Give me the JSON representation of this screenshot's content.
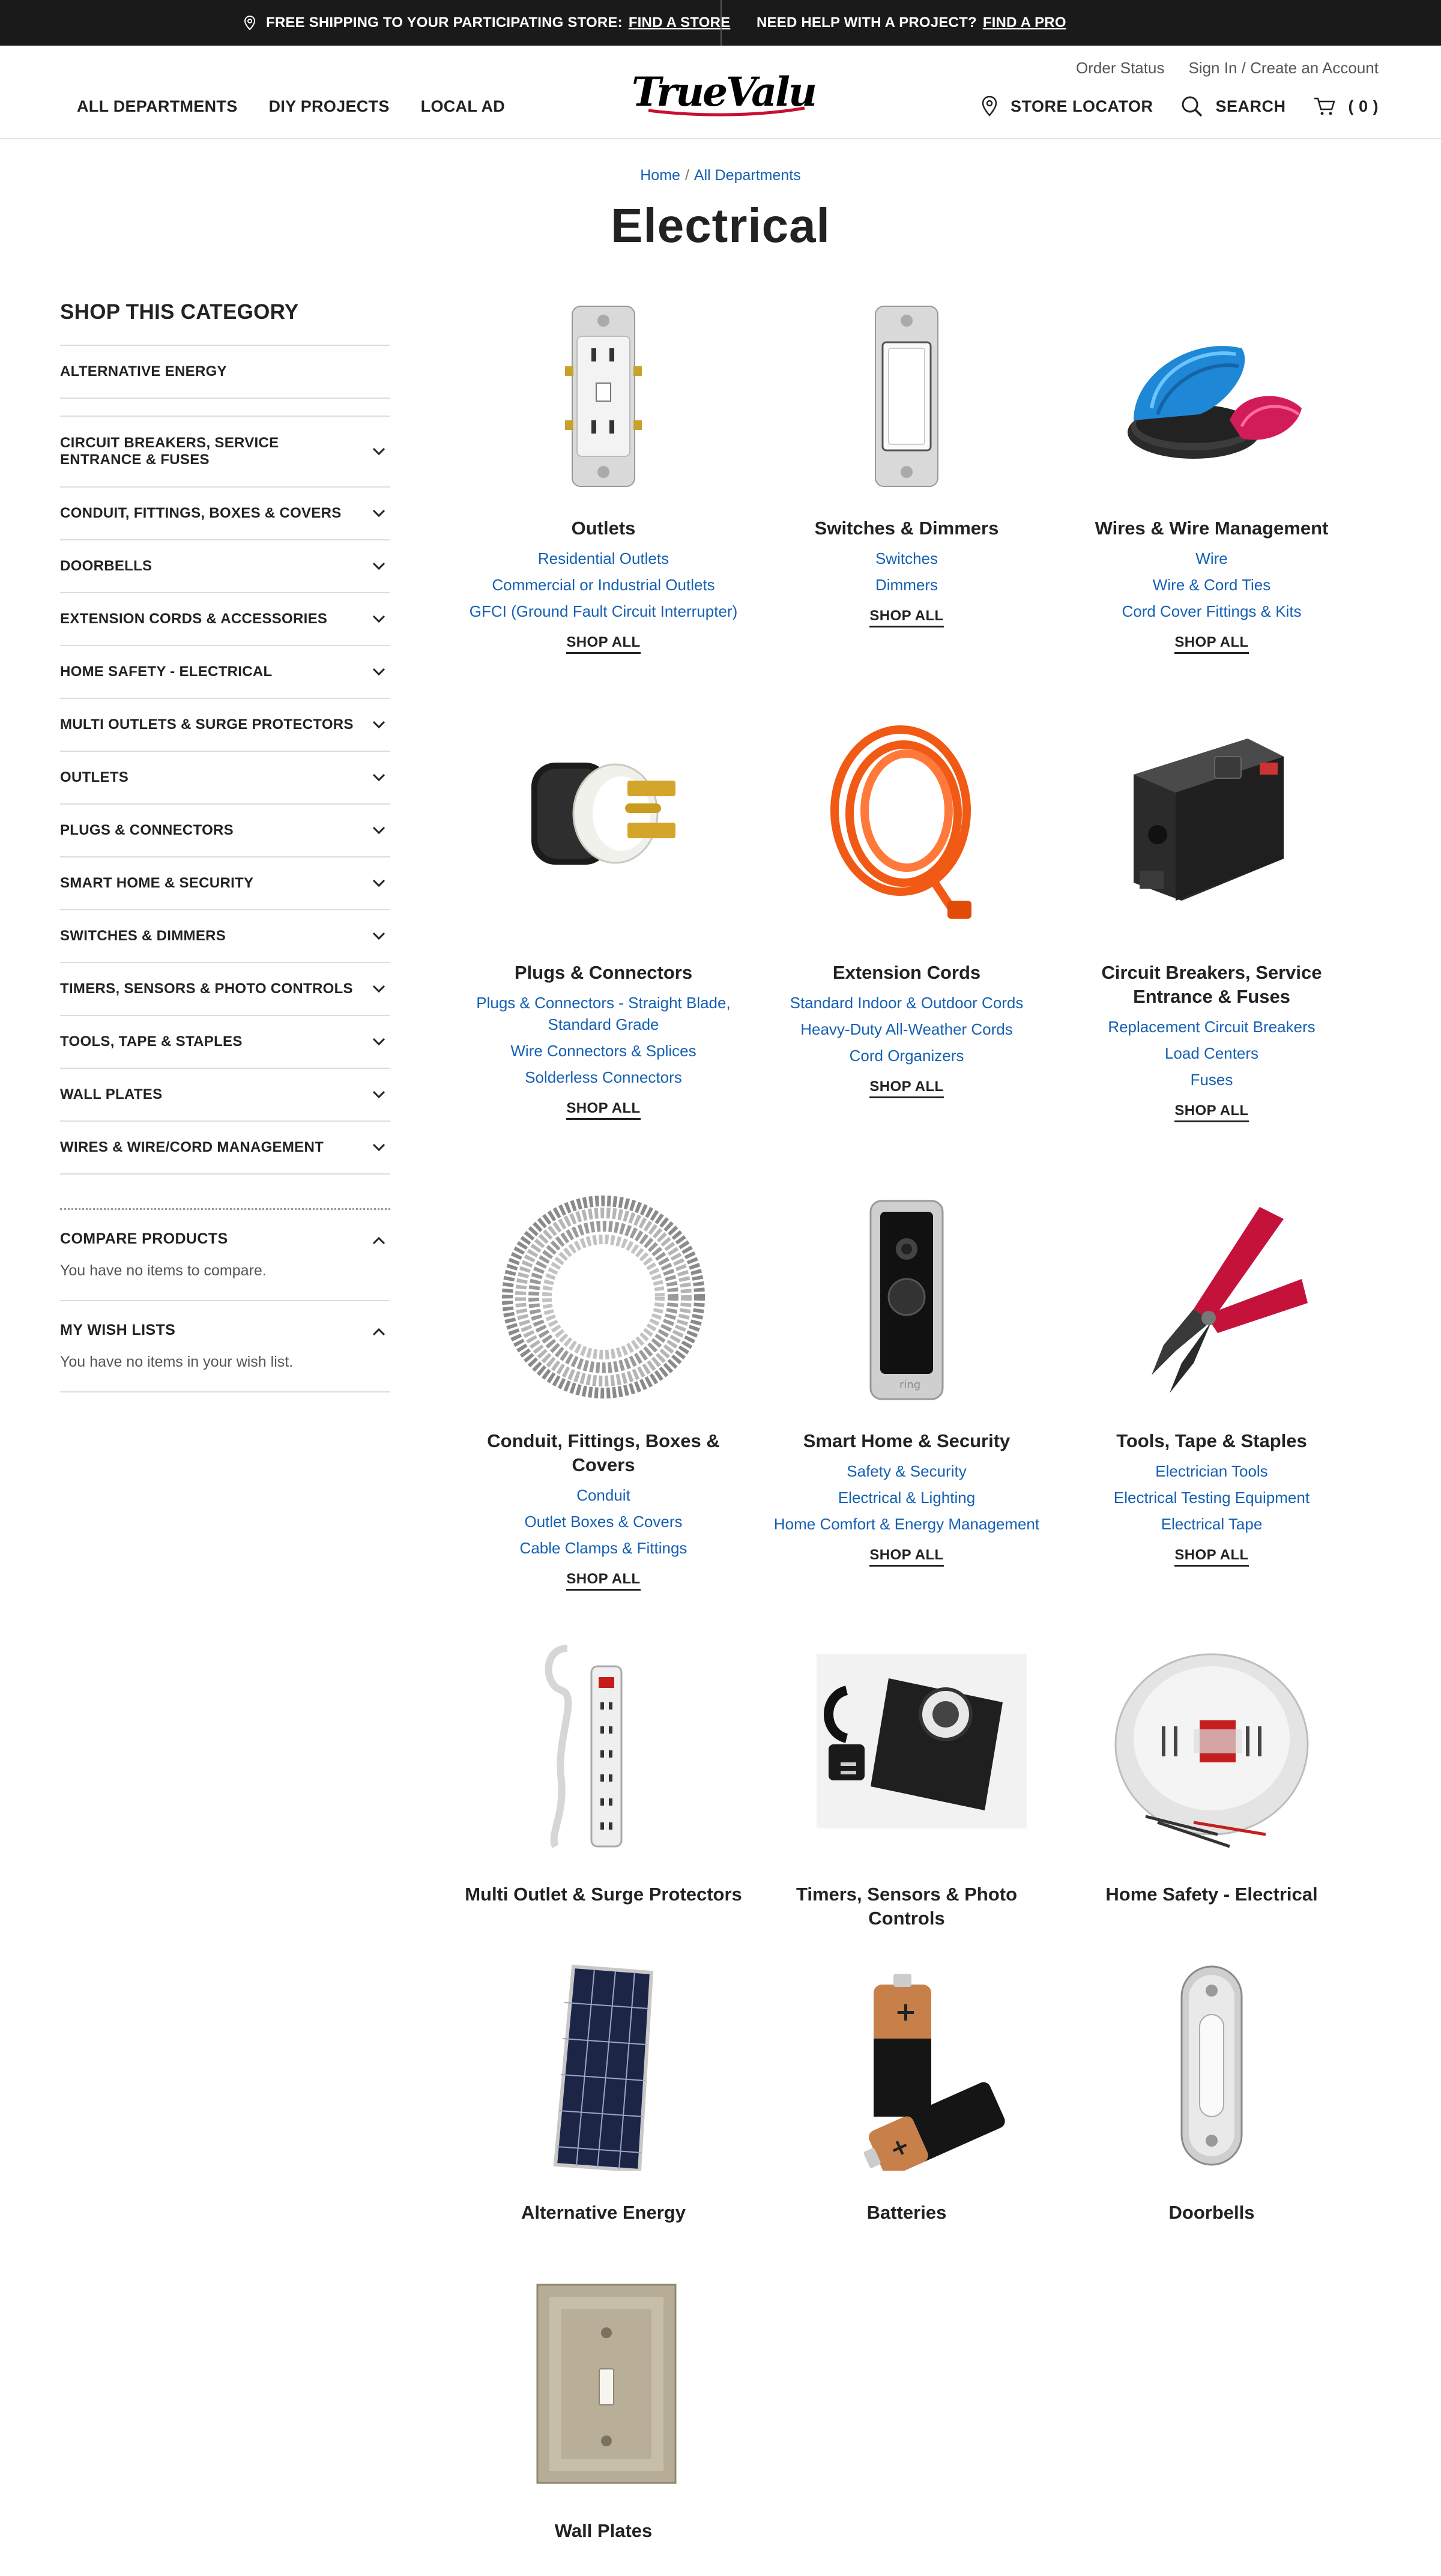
{
  "promo": {
    "left_text": "FREE SHIPPING TO YOUR PARTICIPATING STORE:",
    "left_link": "FIND A STORE",
    "right_text": "NEED HELP WITH A PROJECT?",
    "right_link": "FIND A PRO"
  },
  "header": {
    "util_links": [
      "Order Status",
      "Sign In / Create an Account"
    ],
    "nav": [
      "ALL DEPARTMENTS",
      "DIY PROJECTS",
      "LOCAL AD"
    ],
    "logo": "TrueValue",
    "store_locator": "STORE LOCATOR",
    "search": "SEARCH",
    "cart": "( 0 )"
  },
  "breadcrumb": [
    "Home",
    "All Departments"
  ],
  "page_title": "Electrical",
  "sidebar": {
    "title": "SHOP THIS CATEGORY",
    "categories": [
      {
        "label": "ALTERNATIVE ENERGY",
        "expandable": false
      },
      {
        "label": "CIRCUIT BREAKERS, SERVICE ENTRANCE & FUSES",
        "expandable": true
      },
      {
        "label": "CONDUIT, FITTINGS, BOXES & COVERS",
        "expandable": true
      },
      {
        "label": "DOORBELLS",
        "expandable": true
      },
      {
        "label": "EXTENSION CORDS & ACCESSORIES",
        "expandable": true
      },
      {
        "label": "HOME SAFETY - ELECTRICAL",
        "expandable": true
      },
      {
        "label": "MULTI OUTLETS & SURGE PROTECTORS",
        "expandable": true
      },
      {
        "label": "OUTLETS",
        "expandable": true
      },
      {
        "label": "PLUGS & CONNECTORS",
        "expandable": true
      },
      {
        "label": "SMART HOME & SECURITY",
        "expandable": true
      },
      {
        "label": "SWITCHES & DIMMERS",
        "expandable": true
      },
      {
        "label": "TIMERS, SENSORS & PHOTO CONTROLS",
        "expandable": true
      },
      {
        "label": "TOOLS, TAPE & STAPLES",
        "expandable": true
      },
      {
        "label": "WALL PLATES",
        "expandable": true
      },
      {
        "label": "WIRES & WIRE/CORD MANAGEMENT",
        "expandable": true
      }
    ],
    "compare_title": "COMPARE PRODUCTS",
    "compare_text": "You have no items to compare.",
    "wishlist_title": "MY WISH LISTS",
    "wishlist_text": "You have no items in your wish list."
  },
  "shop_all_label": "SHOP ALL",
  "tiles": [
    {
      "name": "Outlets",
      "links": [
        "Residential Outlets",
        "Commercial or Industrial Outlets",
        "GFCI (Ground Fault Circuit Interrupter)"
      ],
      "shop_all": true,
      "icon": "outlet-image"
    },
    {
      "name": "Switches & Dimmers",
      "links": [
        "Switches",
        "Dimmers"
      ],
      "shop_all": true,
      "icon": "switch-image"
    },
    {
      "name": "Wires & Wire Management",
      "links": [
        "Wire",
        "Wire & Cord Ties",
        "Cord Cover Fittings & Kits"
      ],
      "shop_all": true,
      "icon": "wire-image"
    },
    {
      "name": "Plugs & Connectors",
      "links": [
        "Plugs & Connectors - Straight Blade, Standard Grade",
        "Wire Connectors & Splices",
        "Solderless Connectors"
      ],
      "shop_all": true,
      "icon": "plug-image"
    },
    {
      "name": "Extension Cords",
      "links": [
        "Standard Indoor & Outdoor Cords",
        "Heavy-Duty All-Weather Cords",
        "Cord Organizers"
      ],
      "shop_all": true,
      "icon": "extension-cord-image"
    },
    {
      "name": "Circuit Breakers, Service Entrance & Fuses",
      "links": [
        "Replacement Circuit Breakers",
        "Load Centers",
        "Fuses"
      ],
      "shop_all": true,
      "icon": "breaker-image"
    },
    {
      "name": "Conduit, Fittings, Boxes & Covers",
      "links": [
        "Conduit",
        "Outlet Boxes & Covers",
        "Cable Clamps & Fittings"
      ],
      "shop_all": true,
      "icon": "conduit-image"
    },
    {
      "name": "Smart Home & Security",
      "links": [
        "Safety & Security",
        "Electrical & Lighting",
        "Home Comfort & Energy Management"
      ],
      "shop_all": true,
      "icon": "doorbell-camera-image"
    },
    {
      "name": "Tools, Tape & Staples",
      "links": [
        "Electrician Tools",
        "Electrical Testing Equipment",
        "Electrical Tape"
      ],
      "shop_all": true,
      "icon": "wire-stripper-image"
    },
    {
      "name": "Multi Outlet & Surge Protectors",
      "links": [],
      "shop_all": false,
      "icon": "power-strip-image"
    },
    {
      "name": "Timers, Sensors & Photo Controls",
      "links": [],
      "shop_all": false,
      "icon": "timer-image"
    },
    {
      "name": "Home Safety - Electrical",
      "links": [],
      "shop_all": false,
      "icon": "smoke-detector-image"
    },
    {
      "name": "Alternative Energy",
      "links": [],
      "shop_all": false,
      "icon": "solar-panel-image"
    },
    {
      "name": "Batteries",
      "links": [],
      "shop_all": false,
      "icon": "battery-image"
    },
    {
      "name": "Doorbells",
      "links": [],
      "shop_all": false,
      "icon": "doorbell-image"
    },
    {
      "name": "Wall Plates",
      "links": [],
      "shop_all": false,
      "icon": "wall-plate-image"
    }
  ],
  "colors": {
    "brand_red": "#c8102e",
    "link_blue": "#1560b3",
    "promo_bg": "#1a1a1a"
  }
}
